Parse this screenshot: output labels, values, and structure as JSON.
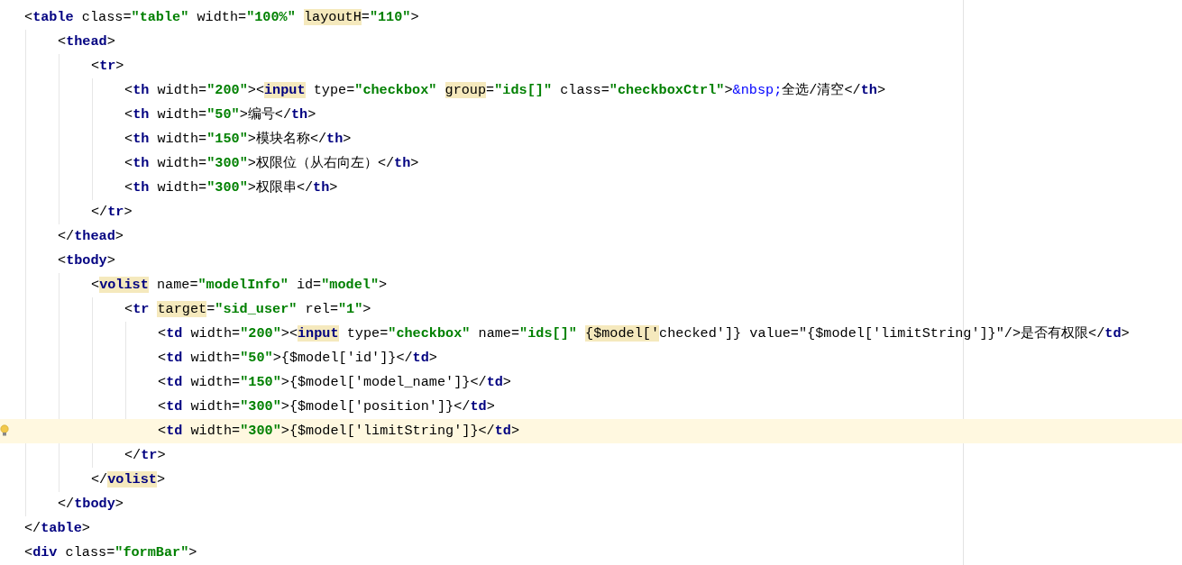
{
  "editor": {
    "lines": [
      {
        "current": false,
        "tokens": [
          {
            "kind": "punct",
            "text": "<"
          },
          {
            "kind": "tag",
            "text": "table"
          },
          {
            "kind": "attr",
            "text": " class="
          },
          {
            "kind": "str",
            "text": "\"table\""
          },
          {
            "kind": "attr",
            "text": " width="
          },
          {
            "kind": "str",
            "text": "\"100%\" "
          },
          {
            "kind": "attr_hl",
            "text": "layoutH"
          },
          {
            "kind": "attr",
            "text": "="
          },
          {
            "kind": "str",
            "text": "\"110\""
          },
          {
            "kind": "punct",
            "text": ">"
          }
        ],
        "children": [
          {
            "current": false,
            "tokens": [
              {
                "kind": "punct",
                "text": "<"
              },
              {
                "kind": "tag",
                "text": "thead"
              },
              {
                "kind": "punct",
                "text": ">"
              }
            ],
            "children": [
              {
                "current": false,
                "tokens": [
                  {
                    "kind": "punct",
                    "text": "<"
                  },
                  {
                    "kind": "tag",
                    "text": "tr"
                  },
                  {
                    "kind": "punct",
                    "text": ">"
                  }
                ],
                "children": [
                  {
                    "current": false,
                    "tokens": [
                      {
                        "kind": "punct",
                        "text": "<"
                      },
                      {
                        "kind": "tag",
                        "text": "th"
                      },
                      {
                        "kind": "attr",
                        "text": " width="
                      },
                      {
                        "kind": "str",
                        "text": "\"200\""
                      },
                      {
                        "kind": "punct",
                        "text": ">"
                      },
                      {
                        "kind": "punct",
                        "text": "<"
                      },
                      {
                        "kind": "tag_hl",
                        "text": "input"
                      },
                      {
                        "kind": "attr",
                        "text": " type="
                      },
                      {
                        "kind": "str",
                        "text": "\"checkbox\" "
                      },
                      {
                        "kind": "attr_hl",
                        "text": "group"
                      },
                      {
                        "kind": "attr",
                        "text": "="
                      },
                      {
                        "kind": "str",
                        "text": "\"ids[]\""
                      },
                      {
                        "kind": "attr",
                        "text": " class="
                      },
                      {
                        "kind": "str",
                        "text": "\"checkboxCtrl\""
                      },
                      {
                        "kind": "punct",
                        "text": ">"
                      },
                      {
                        "kind": "entity",
                        "text": "&nbsp;"
                      },
                      {
                        "kind": "text",
                        "text": "全选/清空"
                      },
                      {
                        "kind": "punct",
                        "text": "</"
                      },
                      {
                        "kind": "tag",
                        "text": "th"
                      },
                      {
                        "kind": "punct",
                        "text": ">"
                      }
                    ]
                  },
                  {
                    "current": false,
                    "tokens": [
                      {
                        "kind": "punct",
                        "text": "<"
                      },
                      {
                        "kind": "tag",
                        "text": "th"
                      },
                      {
                        "kind": "attr",
                        "text": " width="
                      },
                      {
                        "kind": "str",
                        "text": "\"50\""
                      },
                      {
                        "kind": "punct",
                        "text": ">"
                      },
                      {
                        "kind": "text",
                        "text": "编号"
                      },
                      {
                        "kind": "punct",
                        "text": "</"
                      },
                      {
                        "kind": "tag",
                        "text": "th"
                      },
                      {
                        "kind": "punct",
                        "text": ">"
                      }
                    ]
                  },
                  {
                    "current": false,
                    "tokens": [
                      {
                        "kind": "punct",
                        "text": "<"
                      },
                      {
                        "kind": "tag",
                        "text": "th"
                      },
                      {
                        "kind": "attr",
                        "text": " width="
                      },
                      {
                        "kind": "str",
                        "text": "\"150\""
                      },
                      {
                        "kind": "punct",
                        "text": ">"
                      },
                      {
                        "kind": "text",
                        "text": "模块名称"
                      },
                      {
                        "kind": "punct",
                        "text": "</"
                      },
                      {
                        "kind": "tag",
                        "text": "th"
                      },
                      {
                        "kind": "punct",
                        "text": ">"
                      }
                    ]
                  },
                  {
                    "current": false,
                    "tokens": [
                      {
                        "kind": "punct",
                        "text": "<"
                      },
                      {
                        "kind": "tag",
                        "text": "th"
                      },
                      {
                        "kind": "attr",
                        "text": " width="
                      },
                      {
                        "kind": "str",
                        "text": "\"300\""
                      },
                      {
                        "kind": "punct",
                        "text": ">"
                      },
                      {
                        "kind": "text",
                        "text": "权限位（从右向左）"
                      },
                      {
                        "kind": "punct",
                        "text": "</"
                      },
                      {
                        "kind": "tag",
                        "text": "th"
                      },
                      {
                        "kind": "punct",
                        "text": ">"
                      }
                    ]
                  },
                  {
                    "current": false,
                    "tokens": [
                      {
                        "kind": "punct",
                        "text": "<"
                      },
                      {
                        "kind": "tag",
                        "text": "th"
                      },
                      {
                        "kind": "attr",
                        "text": " width="
                      },
                      {
                        "kind": "str",
                        "text": "\"300\""
                      },
                      {
                        "kind": "punct",
                        "text": ">"
                      },
                      {
                        "kind": "text",
                        "text": "权限串"
                      },
                      {
                        "kind": "punct",
                        "text": "</"
                      },
                      {
                        "kind": "tag",
                        "text": "th"
                      },
                      {
                        "kind": "punct",
                        "text": ">"
                      }
                    ]
                  }
                ]
              },
              {
                "current": false,
                "tokens": [
                  {
                    "kind": "punct",
                    "text": "</"
                  },
                  {
                    "kind": "tag",
                    "text": "tr"
                  },
                  {
                    "kind": "punct",
                    "text": ">"
                  }
                ]
              }
            ]
          },
          {
            "current": false,
            "tokens": [
              {
                "kind": "punct",
                "text": "</"
              },
              {
                "kind": "tag",
                "text": "thead"
              },
              {
                "kind": "punct",
                "text": ">"
              }
            ]
          },
          {
            "current": false,
            "tokens": [
              {
                "kind": "punct",
                "text": "<"
              },
              {
                "kind": "tag",
                "text": "tbody"
              },
              {
                "kind": "punct",
                "text": ">"
              }
            ],
            "children": [
              {
                "current": false,
                "tokens": [
                  {
                    "kind": "punct",
                    "text": "<"
                  },
                  {
                    "kind": "tag_hl",
                    "text": "volist"
                  },
                  {
                    "kind": "attr",
                    "text": " name="
                  },
                  {
                    "kind": "str",
                    "text": "\"modelInfo\""
                  },
                  {
                    "kind": "attr",
                    "text": " id="
                  },
                  {
                    "kind": "str",
                    "text": "\"model\""
                  },
                  {
                    "kind": "punct",
                    "text": ">"
                  }
                ],
                "children": [
                  {
                    "current": false,
                    "tokens": [
                      {
                        "kind": "punct",
                        "text": "<"
                      },
                      {
                        "kind": "tag",
                        "text": "tr "
                      },
                      {
                        "kind": "attr_hl",
                        "text": "target"
                      },
                      {
                        "kind": "attr",
                        "text": "="
                      },
                      {
                        "kind": "str",
                        "text": "\"sid_user\""
                      },
                      {
                        "kind": "attr",
                        "text": " rel="
                      },
                      {
                        "kind": "str",
                        "text": "\"1\""
                      },
                      {
                        "kind": "punct",
                        "text": ">"
                      }
                    ],
                    "children": [
                      {
                        "current": false,
                        "tokens": [
                          {
                            "kind": "punct",
                            "text": "<"
                          },
                          {
                            "kind": "tag",
                            "text": "td"
                          },
                          {
                            "kind": "attr",
                            "text": " width="
                          },
                          {
                            "kind": "str",
                            "text": "\"200\""
                          },
                          {
                            "kind": "punct",
                            "text": ">"
                          },
                          {
                            "kind": "punct",
                            "text": "<"
                          },
                          {
                            "kind": "tag_hl",
                            "text": "input"
                          },
                          {
                            "kind": "attr",
                            "text": " type="
                          },
                          {
                            "kind": "str",
                            "text": "\"checkbox\""
                          },
                          {
                            "kind": "attr",
                            "text": " name="
                          },
                          {
                            "kind": "str",
                            "text": "\"ids[]\" "
                          },
                          {
                            "kind": "attr_hl",
                            "text": "{$model['"
                          },
                          {
                            "kind": "text",
                            "text": "checked']} value=\"{$model['limitString']}\"/>是否有权限"
                          },
                          {
                            "kind": "punct",
                            "text": "</"
                          },
                          {
                            "kind": "tag",
                            "text": "td"
                          },
                          {
                            "kind": "punct",
                            "text": ">"
                          }
                        ]
                      },
                      {
                        "current": false,
                        "tokens": [
                          {
                            "kind": "punct",
                            "text": "<"
                          },
                          {
                            "kind": "tag",
                            "text": "td"
                          },
                          {
                            "kind": "attr",
                            "text": " width="
                          },
                          {
                            "kind": "str",
                            "text": "\"50\""
                          },
                          {
                            "kind": "punct",
                            "text": ">"
                          },
                          {
                            "kind": "text",
                            "text": "{$model['id']}"
                          },
                          {
                            "kind": "punct",
                            "text": "</"
                          },
                          {
                            "kind": "tag",
                            "text": "td"
                          },
                          {
                            "kind": "punct",
                            "text": ">"
                          }
                        ]
                      },
                      {
                        "current": false,
                        "tokens": [
                          {
                            "kind": "punct",
                            "text": "<"
                          },
                          {
                            "kind": "tag",
                            "text": "td"
                          },
                          {
                            "kind": "attr",
                            "text": " width="
                          },
                          {
                            "kind": "str",
                            "text": "\"150\""
                          },
                          {
                            "kind": "punct",
                            "text": ">"
                          },
                          {
                            "kind": "text",
                            "text": "{$model['model_name']}"
                          },
                          {
                            "kind": "punct",
                            "text": "</"
                          },
                          {
                            "kind": "tag",
                            "text": "td"
                          },
                          {
                            "kind": "punct",
                            "text": ">"
                          }
                        ]
                      },
                      {
                        "current": false,
                        "tokens": [
                          {
                            "kind": "punct",
                            "text": "<"
                          },
                          {
                            "kind": "tag",
                            "text": "td"
                          },
                          {
                            "kind": "attr",
                            "text": " width="
                          },
                          {
                            "kind": "str",
                            "text": "\"300\""
                          },
                          {
                            "kind": "punct",
                            "text": ">"
                          },
                          {
                            "kind": "text",
                            "text": "{$model['position']}"
                          },
                          {
                            "kind": "punct",
                            "text": "</"
                          },
                          {
                            "kind": "tag",
                            "text": "td"
                          },
                          {
                            "kind": "punct",
                            "text": ">"
                          }
                        ]
                      },
                      {
                        "current": true,
                        "tokens": [
                          {
                            "kind": "punct",
                            "text": "<"
                          },
                          {
                            "kind": "tag",
                            "text": "td"
                          },
                          {
                            "kind": "attr",
                            "text": " width="
                          },
                          {
                            "kind": "str",
                            "text": "\"300\""
                          },
                          {
                            "kind": "punct",
                            "text": ">"
                          },
                          {
                            "kind": "text",
                            "text": "{$model['limitString']}"
                          },
                          {
                            "kind": "punct",
                            "text": "</"
                          },
                          {
                            "kind": "tag",
                            "text": "td"
                          },
                          {
                            "kind": "punct",
                            "text": ">"
                          }
                        ]
                      }
                    ]
                  },
                  {
                    "current": false,
                    "tokens": [
                      {
                        "kind": "punct",
                        "text": "</"
                      },
                      {
                        "kind": "tag",
                        "text": "tr"
                      },
                      {
                        "kind": "punct",
                        "text": ">"
                      }
                    ]
                  }
                ]
              },
              {
                "current": false,
                "tokens": [
                  {
                    "kind": "punct",
                    "text": "</"
                  },
                  {
                    "kind": "tag_hl",
                    "text": "volist"
                  },
                  {
                    "kind": "punct",
                    "text": ">"
                  }
                ]
              }
            ]
          },
          {
            "current": false,
            "tokens": [
              {
                "kind": "punct",
                "text": "</"
              },
              {
                "kind": "tag",
                "text": "tbody"
              },
              {
                "kind": "punct",
                "text": ">"
              }
            ]
          }
        ]
      },
      {
        "current": false,
        "tokens": [
          {
            "kind": "punct",
            "text": "</"
          },
          {
            "kind": "tag",
            "text": "table"
          },
          {
            "kind": "punct",
            "text": ">"
          }
        ]
      },
      {
        "current": false,
        "tokens": [
          {
            "kind": "punct",
            "text": "<"
          },
          {
            "kind": "tag",
            "text": "div"
          },
          {
            "kind": "attr",
            "text": " class="
          },
          {
            "kind": "str",
            "text": "\"formBar\""
          },
          {
            "kind": "punct",
            "text": ">"
          }
        ]
      }
    ]
  }
}
